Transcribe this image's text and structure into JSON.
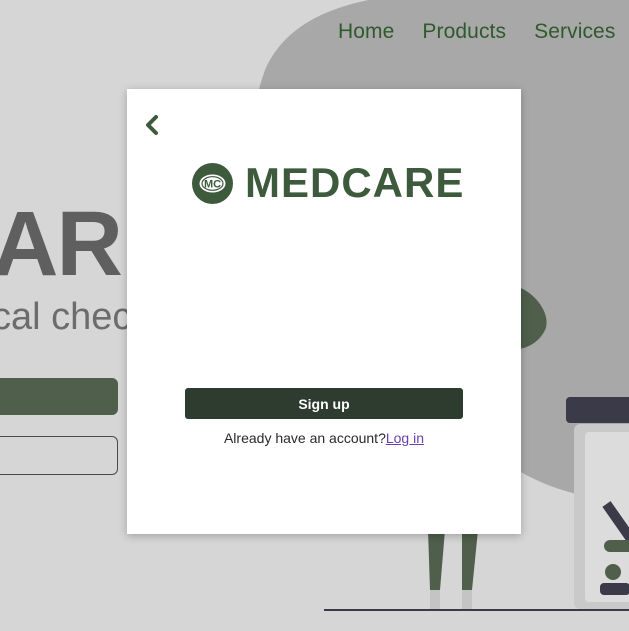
{
  "nav": {
    "items": [
      "Home",
      "Products",
      "Services"
    ]
  },
  "hero": {
    "title": "AR",
    "subtitle": "cal chec"
  },
  "modal": {
    "brand_name": "MEDCARE",
    "logo_initials": "MC",
    "signup_label": "Sign up",
    "login_prompt": "Already have an account?",
    "login_link": "Log in"
  },
  "colors": {
    "accent_green": "#3d5a3d",
    "dark_button": "#2e3b2f",
    "link_purple": "#6a3fb5",
    "nav_green": "#2f5a2d"
  },
  "icons": {
    "back": "chevron-left-icon",
    "logo": "medcare-logo-icon"
  }
}
